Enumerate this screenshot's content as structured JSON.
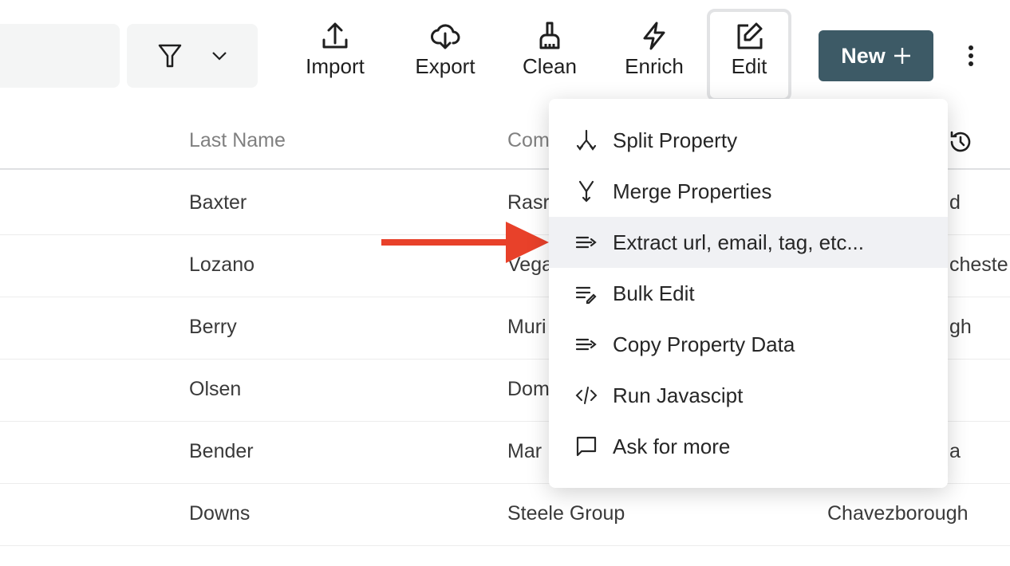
{
  "toolbar": {
    "import": "Import",
    "export": "Export",
    "clean": "Clean",
    "enrich": "Enrich",
    "edit": "Edit",
    "new": "New",
    "new_icon": "plus-icon",
    "filter_icon": "filter-icon",
    "more_icon": "vertical-dots-icon"
  },
  "table": {
    "headers": {
      "last_name": "Last Name",
      "company": "Com"
    },
    "rows": [
      {
        "last_name": "Baxter",
        "company": "Rasr",
        "city": "d"
      },
      {
        "last_name": "Lozano",
        "company": "Vega",
        "city": "cheste"
      },
      {
        "last_name": "Berry",
        "company": "Muri",
        "city": "gh"
      },
      {
        "last_name": "Olsen",
        "company": "Dom",
        "city": ""
      },
      {
        "last_name": "Bender",
        "company": "Mar",
        "city": "a"
      },
      {
        "last_name": "Downs",
        "company": "Steele Group",
        "city": "Chavezborough"
      }
    ]
  },
  "menu": {
    "items": [
      {
        "label": "Split Property",
        "icon": "split-icon"
      },
      {
        "label": "Merge Properties",
        "icon": "merge-icon"
      },
      {
        "label": "Extract url, email, tag, etc...",
        "icon": "extract-icon",
        "highlighted": true
      },
      {
        "label": "Bulk Edit",
        "icon": "bulk-edit-icon"
      },
      {
        "label": "Copy Property Data",
        "icon": "copy-data-icon"
      },
      {
        "label": "Run Javascipt",
        "icon": "code-icon"
      },
      {
        "label": "Ask for more",
        "icon": "chat-icon"
      }
    ]
  },
  "colors": {
    "accent": "#3d5a66",
    "arrow": "#e8412a",
    "highlight": "#f0f1f4"
  }
}
